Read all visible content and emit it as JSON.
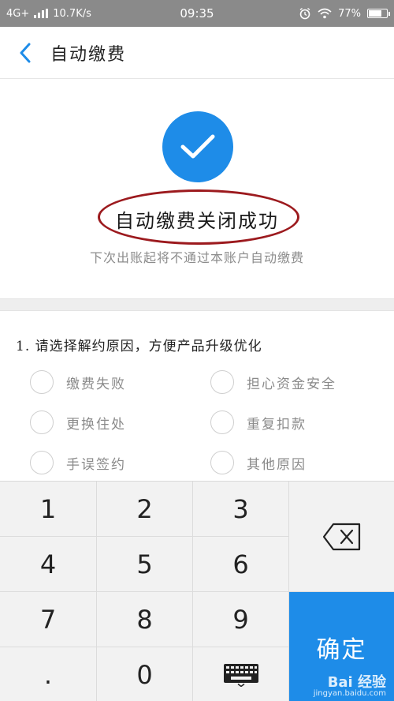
{
  "status_bar": {
    "network": "4G+",
    "speed": "10.7K/s",
    "time": "09:35",
    "battery": "77%",
    "battery_level": 0.77
  },
  "header": {
    "title": "自动缴费"
  },
  "success": {
    "message": "自动缴费关闭成功",
    "subtext": "下次出账起将不通过本账户自动缴费",
    "check_color": "#1e8ce8",
    "highlight_color": "#9c1a1e"
  },
  "survey": {
    "question": "1. 请选择解约原因，方便产品升级优化",
    "options": [
      {
        "label": "缴费失败",
        "selected": false
      },
      {
        "label": "担心资金安全",
        "selected": false
      },
      {
        "label": "更换住处",
        "selected": false
      },
      {
        "label": "重复扣款",
        "selected": false
      },
      {
        "label": "手误签约",
        "selected": false
      },
      {
        "label": "其他原因",
        "selected": false
      }
    ]
  },
  "keypad": {
    "keys": [
      "1",
      "2",
      "3",
      "4",
      "5",
      "6",
      "7",
      "8",
      "9",
      ".",
      "0"
    ],
    "confirm_label": "确定",
    "delete_icon": "backspace-icon",
    "hide_icon": "keyboard-icon",
    "accent_color": "#1e8ce8"
  },
  "watermark": {
    "main": "Bai 经验",
    "sub": "jingyan.baidu.com"
  }
}
